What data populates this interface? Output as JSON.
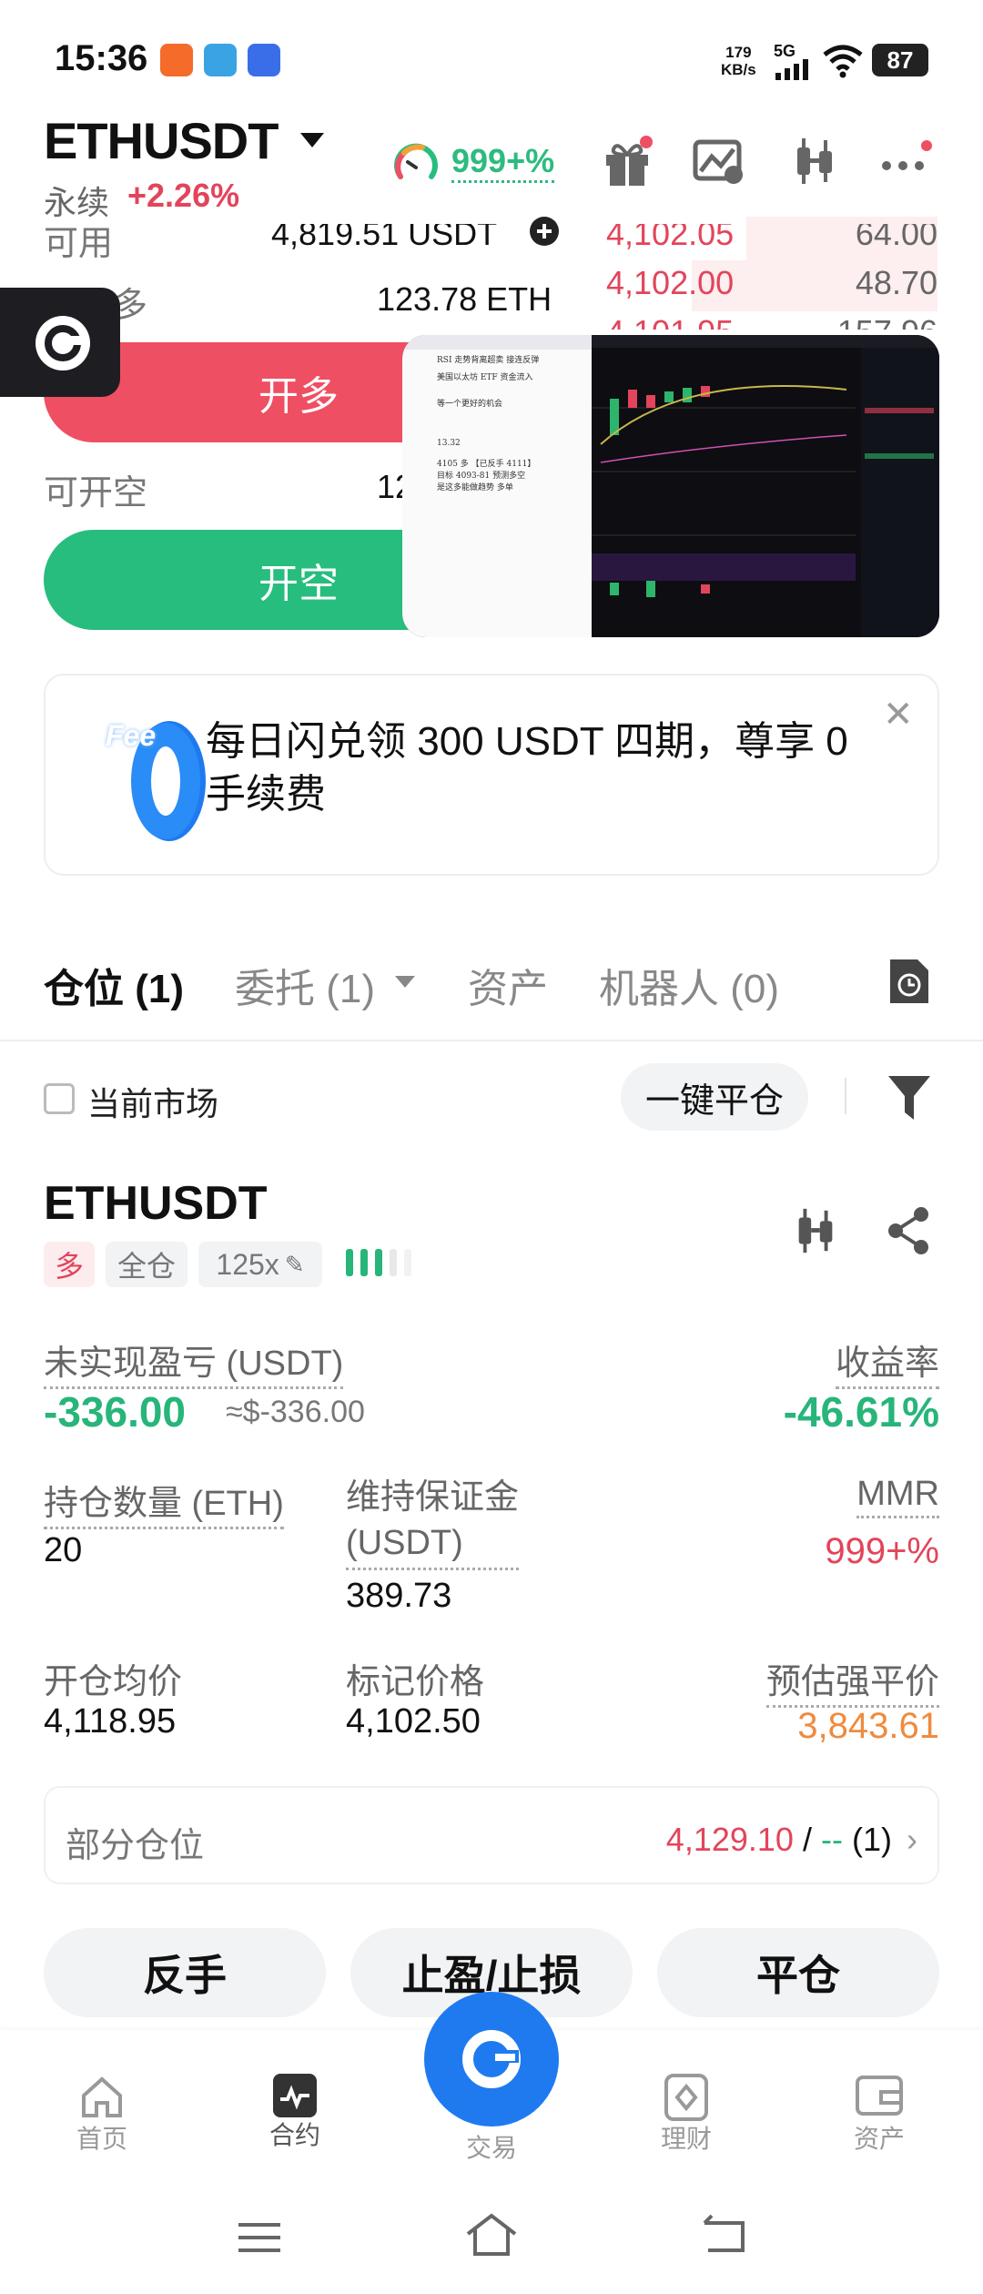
{
  "status_bar": {
    "time": "15:36",
    "net_speed_value": "179",
    "net_speed_unit": "KB/s",
    "network": "5G",
    "battery": "87"
  },
  "header": {
    "pair": "ETHUSDT",
    "contract_type": "永续",
    "change": "+2.26%",
    "gauge_percent": "999+%"
  },
  "order_panel": {
    "available_label": "可用",
    "available_value": "4,819.51 USDT",
    "can_long_label": "可开多",
    "can_long_value": "123.78 ETH",
    "long_button": "开多",
    "can_short_label": "可开空",
    "can_short_value": "12",
    "short_button": "开空"
  },
  "order_book": [
    {
      "price": "4,102.05",
      "qty": "64.00"
    },
    {
      "price": "4,102.00",
      "qty": "48.70"
    },
    {
      "price": "4,101.95",
      "qty": "157.96"
    }
  ],
  "banner": {
    "badge": "Fee",
    "badge_num": "0",
    "text": "每日闪兑领 300 USDT 四期，尊享 0 手续费"
  },
  "tabs": [
    {
      "label": "仓位 (1)"
    },
    {
      "label": "委托 (1)"
    },
    {
      "label": "资产"
    },
    {
      "label": "机器人 (0)"
    }
  ],
  "filter": {
    "current_market": "当前市场",
    "close_all": "一键平仓"
  },
  "position": {
    "symbol": "ETHUSDT",
    "side": "多",
    "margin_mode": "全仓",
    "leverage": "125x",
    "unrealized_label": "未实现盈亏 (USDT)",
    "unrealized_value": "-336.00",
    "unrealized_approx": "≈$-336.00",
    "roe_label": "收益率",
    "roe_value": "-46.61%",
    "size_label": "持仓数量 (ETH)",
    "size_value": "20",
    "maint_margin_label_1": "维持保证金",
    "maint_margin_label_2": "(USDT)",
    "maint_margin_value": "389.73",
    "mmr_label": "MMR",
    "mmr_value": "999+%",
    "entry_label": "开仓均价",
    "entry_value": "4,118.95",
    "mark_label": "标记价格",
    "mark_value": "4,102.50",
    "liq_label": "预估强平价",
    "liq_value": "3,843.61",
    "partial_label": "部分仓位",
    "partial_price": "4,129.10",
    "partial_sep": "/",
    "partial_dash": "--",
    "partial_count": "(1)"
  },
  "actions": {
    "reverse": "反手",
    "tp_sl": "止盈/止损",
    "close": "平仓"
  },
  "bottom_nav": [
    {
      "label": "首页",
      "icon": "home-icon"
    },
    {
      "label": "合约",
      "icon": "futures-icon"
    },
    {
      "label": "交易",
      "icon": "trade-icon"
    },
    {
      "label": "理财",
      "icon": "earn-icon"
    },
    {
      "label": "资产",
      "icon": "wallet-icon"
    }
  ],
  "pip_text": [
    "RSI 走势背离超卖 接连反弹",
    "美国以太坊 ETF 资金流入",
    "等一个更好的机会",
    "13.32",
    "4105 多 【已反手 4111】",
    "目标 4093-81 预测多空",
    "是这多能做趋势 多单"
  ],
  "colors": {
    "long": "#ef4f63",
    "short": "#27bd7e",
    "accent": "#1f7af0"
  }
}
